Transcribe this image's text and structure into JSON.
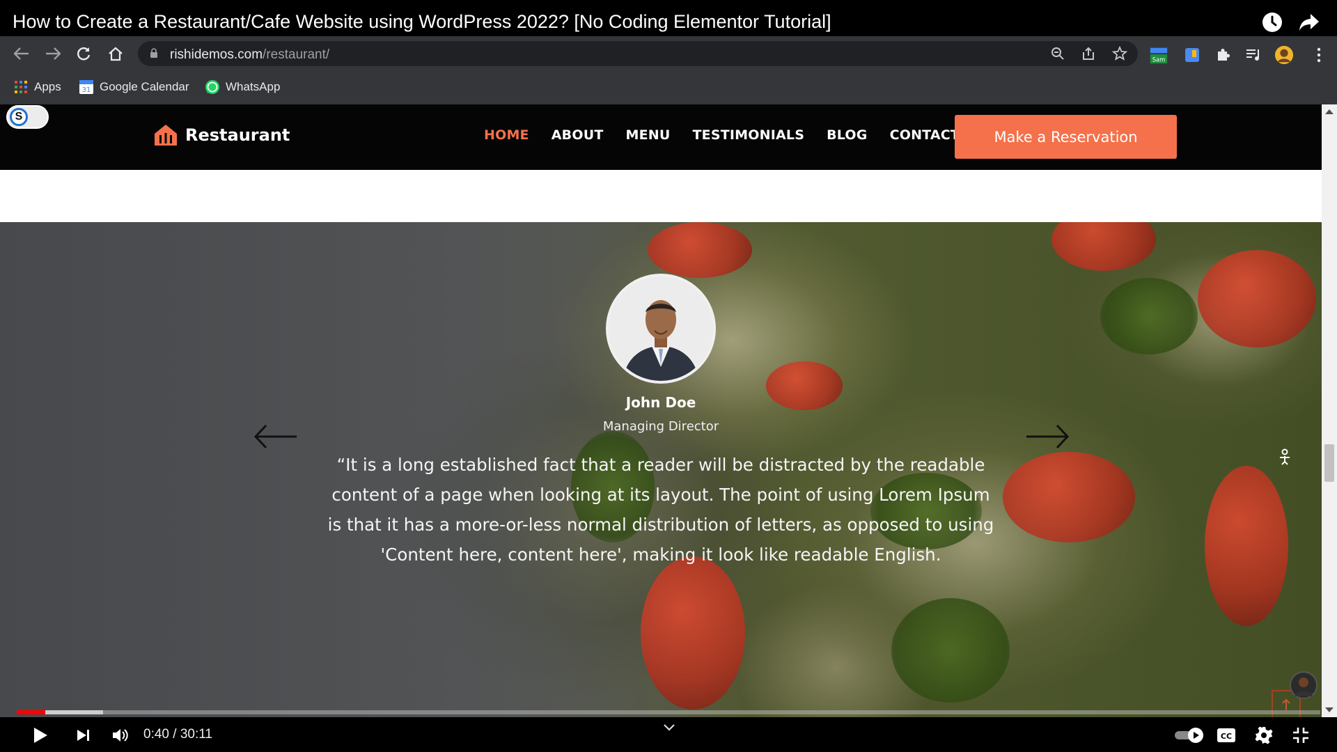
{
  "video": {
    "title": "How to Create a Restaurant/Cafe Website using WordPress 2022? [No Coding Elementor Tutorial]",
    "time_current": "0:40",
    "time_separator": " / ",
    "time_total": "30:11",
    "progress_played": 0.022,
    "progress_buffered": 0.066
  },
  "browser": {
    "url_host": "rishidemos.com",
    "url_path": "/restaurant/",
    "bookmarks": [
      {
        "label": "Apps",
        "icon": "apps-grid-icon"
      },
      {
        "label": "Google Calendar",
        "icon": "calendar-icon"
      },
      {
        "label": "WhatsApp",
        "icon": "whatsapp-icon"
      }
    ],
    "extension_badge": "Sam"
  },
  "site": {
    "toggle_letter": "S",
    "logo_name": "Restaurant",
    "menu": [
      {
        "label": "HOME",
        "active": true
      },
      {
        "label": "ABOUT",
        "active": false
      },
      {
        "label": "MENU",
        "active": false
      },
      {
        "label": "TESTIMONIALS",
        "active": false
      },
      {
        "label": "BLOG",
        "active": false
      },
      {
        "label": "CONTACT",
        "active": false
      }
    ],
    "cta_label": "Make a Reservation",
    "testimonial": {
      "name": "John Doe",
      "role": "Managing Director",
      "quote": "“It is a long established fact that a reader will be distracted by the readable content of a page when looking at its layout. The point of using Lorem Ipsum is that it has a more-or-less normal distribution of letters, as opposed to using 'Content here, content here', making it look like readable English."
    }
  },
  "colors": {
    "accent": "#f4714b",
    "player_red": "#ff0000",
    "header_bg": "#050505",
    "chrome_bg": "#35363a"
  }
}
